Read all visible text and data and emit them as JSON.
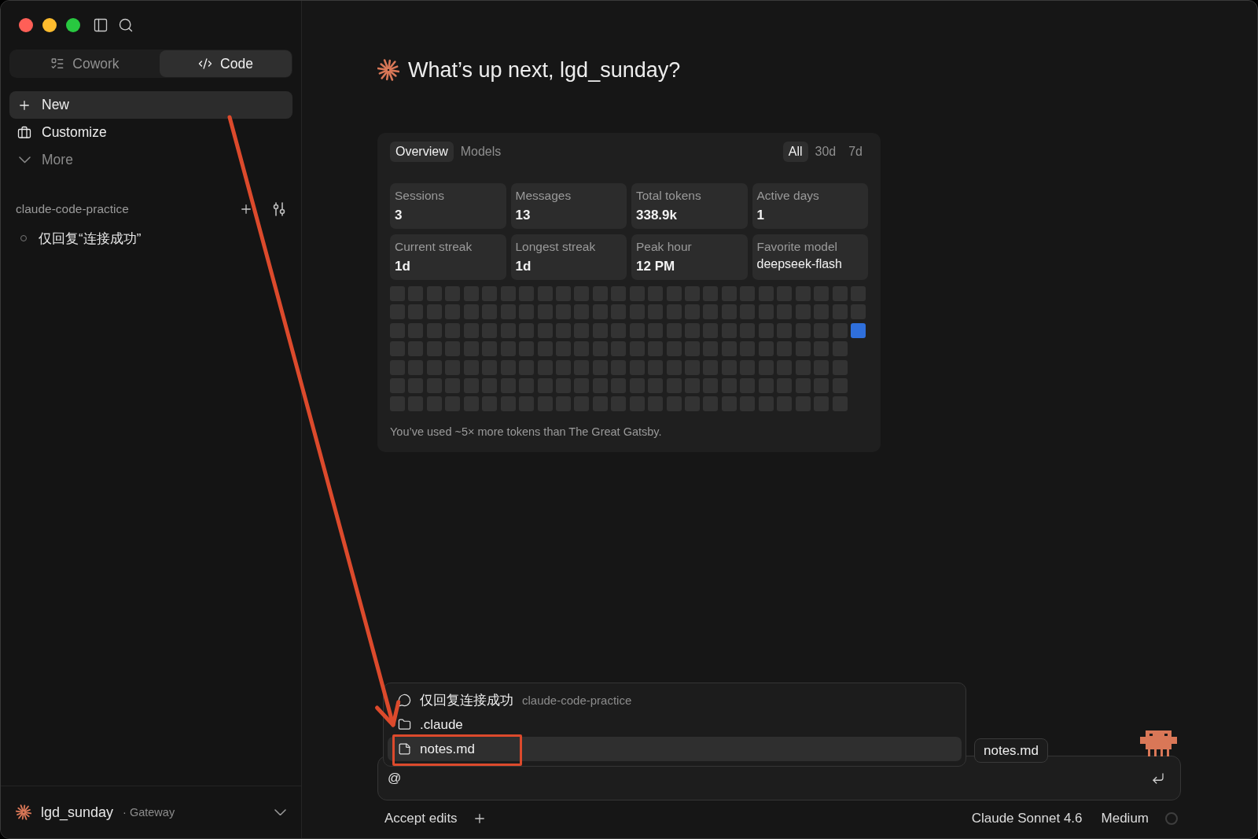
{
  "sidebar": {
    "mode_tabs": [
      {
        "label": "Cowork",
        "selected": false
      },
      {
        "label": "Code",
        "selected": true
      }
    ],
    "nav_items": [
      {
        "kind": "action",
        "label": "New",
        "selected": true
      },
      {
        "kind": "link",
        "label": "Customize",
        "selected": false
      },
      {
        "kind": "expander",
        "label": "More",
        "selected": false
      }
    ],
    "project": {
      "name": "claude-code-practice",
      "sessions": [
        {
          "title": "仅回复“连接成功”",
          "selected": false
        }
      ]
    },
    "account": {
      "name": "lgd_sunday",
      "plan": "· Gateway"
    }
  },
  "main": {
    "greeting": "What’s up next, lgd_sunday?",
    "stats": {
      "view_tabs": [
        {
          "label": "Overview",
          "selected": true
        },
        {
          "label": "Models",
          "selected": false
        }
      ],
      "range_tabs": [
        {
          "label": "All",
          "selected": true
        },
        {
          "label": "30d",
          "selected": false
        },
        {
          "label": "7d",
          "selected": false
        }
      ],
      "tiles": [
        {
          "kind": "number",
          "label": "Sessions",
          "value": "3"
        },
        {
          "kind": "number",
          "label": "Messages",
          "value": "13"
        },
        {
          "kind": "number",
          "label": "Total tokens",
          "value": "338.9k"
        },
        {
          "kind": "number",
          "label": "Active days",
          "value": "1"
        },
        {
          "kind": "number",
          "label": "Current streak",
          "value": "1d"
        },
        {
          "kind": "number",
          "label": "Longest streak",
          "value": "1d"
        },
        {
          "kind": "number",
          "label": "Peak hour",
          "value": "12 PM"
        },
        {
          "kind": "text",
          "label": "Favorite model",
          "value": "deepseek-flash"
        }
      ],
      "activity_weeks": [
        [
          {
            "active": false
          },
          {
            "active": false
          },
          {
            "active": false
          },
          {
            "active": false
          },
          {
            "active": false
          },
          {
            "active": false
          },
          {
            "active": false
          }
        ],
        [
          {
            "active": false
          },
          {
            "active": false
          },
          {
            "active": false
          },
          {
            "active": false
          },
          {
            "active": false
          },
          {
            "active": false
          },
          {
            "active": false
          }
        ],
        [
          {
            "active": false
          },
          {
            "active": false
          },
          {
            "active": false
          },
          {
            "active": false
          },
          {
            "active": false
          },
          {
            "active": false
          },
          {
            "active": false
          }
        ],
        [
          {
            "active": false
          },
          {
            "active": false
          },
          {
            "active": false
          },
          {
            "active": false
          },
          {
            "active": false
          },
          {
            "active": false
          },
          {
            "active": false
          }
        ],
        [
          {
            "active": false
          },
          {
            "active": false
          },
          {
            "active": false
          },
          {
            "active": false
          },
          {
            "active": false
          },
          {
            "active": false
          },
          {
            "active": false
          }
        ],
        [
          {
            "active": false
          },
          {
            "active": false
          },
          {
            "active": false
          },
          {
            "active": false
          },
          {
            "active": false
          },
          {
            "active": false
          },
          {
            "active": false
          }
        ],
        [
          {
            "active": false
          },
          {
            "active": false
          },
          {
            "active": false
          },
          {
            "active": false
          },
          {
            "active": false
          },
          {
            "active": false
          },
          {
            "active": false
          }
        ],
        [
          {
            "active": false
          },
          {
            "active": false
          },
          {
            "active": false
          },
          {
            "active": false
          },
          {
            "active": false
          },
          {
            "active": false
          },
          {
            "active": false
          }
        ],
        [
          {
            "active": false
          },
          {
            "active": false
          },
          {
            "active": false
          },
          {
            "active": false
          },
          {
            "active": false
          },
          {
            "active": false
          },
          {
            "active": false
          }
        ],
        [
          {
            "active": false
          },
          {
            "active": false
          },
          {
            "active": false
          },
          {
            "active": false
          },
          {
            "active": false
          },
          {
            "active": false
          },
          {
            "active": false
          }
        ],
        [
          {
            "active": false
          },
          {
            "active": false
          },
          {
            "active": false
          },
          {
            "active": false
          },
          {
            "active": false
          },
          {
            "active": false
          },
          {
            "active": false
          }
        ],
        [
          {
            "active": false
          },
          {
            "active": false
          },
          {
            "active": false
          },
          {
            "active": false
          },
          {
            "active": false
          },
          {
            "active": false
          },
          {
            "active": false
          }
        ],
        [
          {
            "active": false
          },
          {
            "active": false
          },
          {
            "active": false
          },
          {
            "active": false
          },
          {
            "active": false
          },
          {
            "active": false
          },
          {
            "active": false
          }
        ],
        [
          {
            "active": false
          },
          {
            "active": false
          },
          {
            "active": false
          },
          {
            "active": false
          },
          {
            "active": false
          },
          {
            "active": false
          },
          {
            "active": false
          }
        ],
        [
          {
            "active": false
          },
          {
            "active": false
          },
          {
            "active": false
          },
          {
            "active": false
          },
          {
            "active": false
          },
          {
            "active": false
          },
          {
            "active": false
          }
        ],
        [
          {
            "active": false
          },
          {
            "active": false
          },
          {
            "active": false
          },
          {
            "active": false
          },
          {
            "active": false
          },
          {
            "active": false
          },
          {
            "active": false
          }
        ],
        [
          {
            "active": false
          },
          {
            "active": false
          },
          {
            "active": false
          },
          {
            "active": false
          },
          {
            "active": false
          },
          {
            "active": false
          },
          {
            "active": false
          }
        ],
        [
          {
            "active": false
          },
          {
            "active": false
          },
          {
            "active": false
          },
          {
            "active": false
          },
          {
            "active": false
          },
          {
            "active": false
          },
          {
            "active": false
          }
        ],
        [
          {
            "active": false
          },
          {
            "active": false
          },
          {
            "active": false
          },
          {
            "active": false
          },
          {
            "active": false
          },
          {
            "active": false
          },
          {
            "active": false
          }
        ],
        [
          {
            "active": false
          },
          {
            "active": false
          },
          {
            "active": false
          },
          {
            "active": false
          },
          {
            "active": false
          },
          {
            "active": false
          },
          {
            "active": false
          }
        ],
        [
          {
            "active": false
          },
          {
            "active": false
          },
          {
            "active": false
          },
          {
            "active": false
          },
          {
            "active": false
          },
          {
            "active": false
          },
          {
            "active": false
          }
        ],
        [
          {
            "active": false
          },
          {
            "active": false
          },
          {
            "active": false
          },
          {
            "active": false
          },
          {
            "active": false
          },
          {
            "active": false
          },
          {
            "active": false
          }
        ],
        [
          {
            "active": false
          },
          {
            "active": false
          },
          {
            "active": false
          },
          {
            "active": false
          },
          {
            "active": false
          },
          {
            "active": false
          },
          {
            "active": false
          }
        ],
        [
          {
            "active": false
          },
          {
            "active": false
          },
          {
            "active": false
          },
          {
            "active": false
          },
          {
            "active": false
          },
          {
            "active": false
          },
          {
            "active": false
          }
        ],
        [
          {
            "active": false
          },
          {
            "active": false
          },
          {
            "active": false
          },
          {
            "active": false
          },
          {
            "active": false
          },
          {
            "active": false
          },
          {
            "active": false
          }
        ],
        [
          {
            "active": false
          },
          {
            "active": false
          },
          {
            "active": true
          }
        ]
      ],
      "note": "You’ve used ~5× more tokens than The Great Gatsby."
    },
    "mention_menu": [
      {
        "kind": "session",
        "label": "仅回复连接成功",
        "detail": "claude-code-practice",
        "selected": false,
        "framed": false
      },
      {
        "kind": "folder",
        "label": ".claude",
        "selected": false,
        "framed": false
      },
      {
        "kind": "file",
        "label": "notes.md",
        "selected": true,
        "framed": true
      }
    ],
    "hover_chip": "notes.md",
    "composer": {
      "value": "@"
    },
    "footer": {
      "mode": "Accept edits",
      "model": "Claude Sonnet 4.6",
      "effort": "Medium"
    }
  },
  "annotation_arrow": true
}
